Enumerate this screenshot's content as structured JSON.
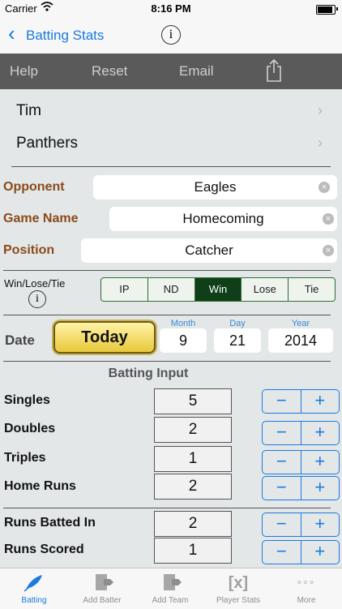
{
  "status_bar": {
    "carrier": "Carrier",
    "time": "8:16 PM"
  },
  "nav": {
    "back_label": "Batting Stats",
    "info_icon": "info-icon"
  },
  "toolbar": {
    "help": "Help",
    "reset": "Reset",
    "email": "Email",
    "share_icon": "share-icon"
  },
  "player": {
    "name": "Tim",
    "team": "Panthers"
  },
  "fields": {
    "opponent": {
      "label": "Opponent",
      "value": "Eagles"
    },
    "game_name": {
      "label": "Game Name",
      "value": "Homecoming"
    },
    "position": {
      "label": "Position",
      "value": "Catcher"
    }
  },
  "result": {
    "label": "Win/Lose/Tie",
    "options": [
      "IP",
      "ND",
      "Win",
      "Lose",
      "Tie"
    ],
    "selected": "Win"
  },
  "date": {
    "label": "Date",
    "today": "Today",
    "month_label": "Month",
    "month": "9",
    "day_label": "Day",
    "day": "21",
    "year_label": "Year",
    "year": "2014"
  },
  "batting": {
    "title": "Batting Input",
    "rows": [
      {
        "label": "Singles",
        "value": "5"
      },
      {
        "label": "Doubles",
        "value": "2"
      },
      {
        "label": "Triples",
        "value": "1"
      },
      {
        "label": "Home Runs",
        "value": "2"
      },
      {
        "label": "Runs Batted In",
        "value": "2"
      },
      {
        "label": "Runs Scored",
        "value": "1"
      }
    ],
    "minus": "−",
    "plus": "+"
  },
  "tabs": [
    {
      "label": "Batting",
      "active": true
    },
    {
      "label": "Add Batter",
      "active": false
    },
    {
      "label": "Add Team",
      "active": false
    },
    {
      "label": "Player Stats",
      "active": false
    },
    {
      "label": "More",
      "active": false
    }
  ],
  "colors": {
    "accent": "#1a7ae0",
    "label_brown": "#8b4a1a",
    "selected_segment": "#0f3f18",
    "toolbar": "#5a5a5a"
  }
}
